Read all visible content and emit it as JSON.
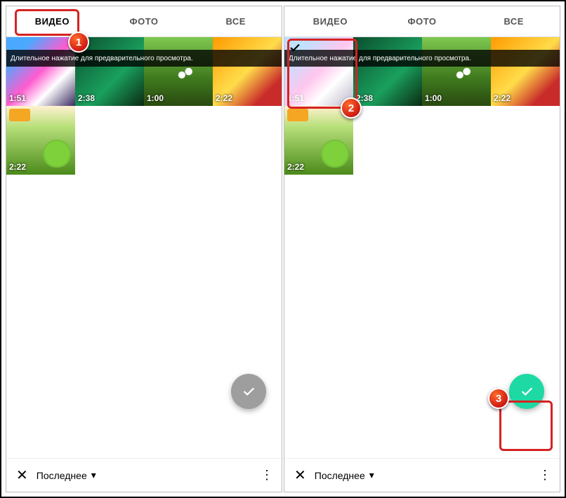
{
  "tabs": {
    "video": "ВИДЕО",
    "photo": "ФОТО",
    "all": "ВСЕ"
  },
  "hint": "Длительное нажатие для предварительного просмотра.",
  "thumbs": {
    "t1": "1:51",
    "t2": "2:38",
    "t3": "1:00",
    "t4": "2:22",
    "t5": "2:22"
  },
  "bottom": {
    "close": "✕",
    "label": "Последнее",
    "chevron": "▾",
    "more": "⋮"
  },
  "badges": {
    "b1": "1",
    "b2": "2",
    "b3": "3"
  }
}
